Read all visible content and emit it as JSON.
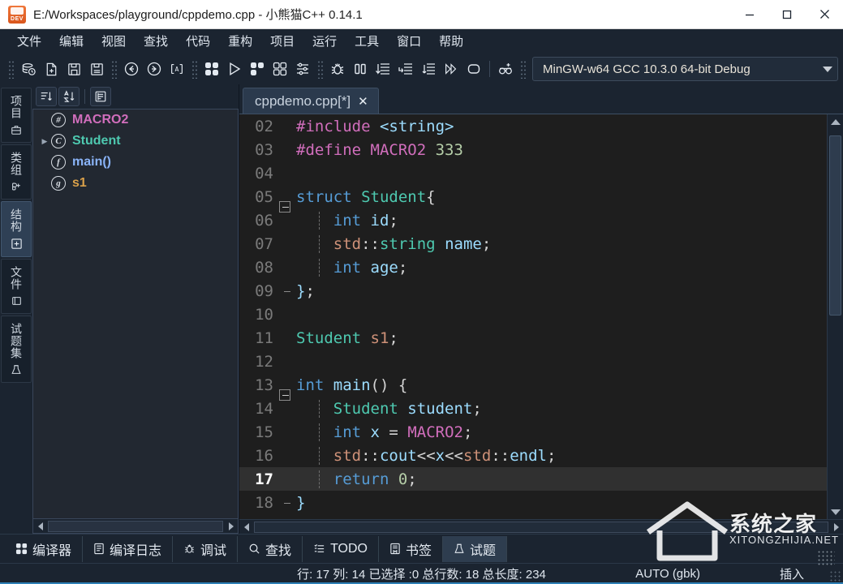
{
  "window": {
    "title_path": "E:/Workspaces/playground/cppdemo.cpp",
    "title_app": " - 小熊猫C++ 0.14.1",
    "icon_label": "DEV",
    "minimize_label": "最小化",
    "maximize_label": "最大化",
    "close_label": "关闭"
  },
  "menubar": {
    "items": [
      {
        "label": "文件",
        "name": "menu-file"
      },
      {
        "label": "编辑",
        "name": "menu-edit"
      },
      {
        "label": "视图",
        "name": "menu-view"
      },
      {
        "label": "查找",
        "name": "menu-search"
      },
      {
        "label": "代码",
        "name": "menu-code"
      },
      {
        "label": "重构",
        "name": "menu-refactor"
      },
      {
        "label": "项目",
        "name": "menu-project"
      },
      {
        "label": "运行",
        "name": "menu-run"
      },
      {
        "label": "工具",
        "name": "menu-tools"
      },
      {
        "label": "窗口",
        "name": "menu-window"
      },
      {
        "label": "帮助",
        "name": "menu-help"
      }
    ]
  },
  "toolbar": {
    "buttons": [
      {
        "name": "open-project-icon",
        "title": "打开项目"
      },
      {
        "name": "new-file-icon",
        "title": "新建文件"
      },
      {
        "name": "save-icon",
        "title": "保存"
      },
      {
        "name": "save-all-icon",
        "title": "全部保存"
      },
      {
        "name": "back-icon",
        "title": "后退"
      },
      {
        "name": "forward-icon",
        "title": "前进"
      },
      {
        "name": "auto-format-icon",
        "title": "格式化"
      },
      {
        "name": "compile-icon",
        "title": "编译"
      },
      {
        "name": "run-icon",
        "title": "运行"
      },
      {
        "name": "compile-run-icon",
        "title": "编译运行"
      },
      {
        "name": "rebuild-icon",
        "title": "重新编译"
      },
      {
        "name": "options-icon",
        "title": "选项"
      },
      {
        "name": "debug-icon",
        "title": "调试"
      },
      {
        "name": "pause-icon",
        "title": "暂停"
      },
      {
        "name": "step-over-icon",
        "title": "单步跳过"
      },
      {
        "name": "step-into-icon",
        "title": "单步进入"
      },
      {
        "name": "step-out-icon",
        "title": "单步跳出"
      },
      {
        "name": "continue-icon",
        "title": "继续"
      },
      {
        "name": "stop-icon",
        "title": "停止"
      },
      {
        "name": "add-watch-icon",
        "title": "添加监视"
      }
    ],
    "compiler_set": "MinGW-w64 GCC 10.3.0 64-bit Debug"
  },
  "left_tabs": [
    {
      "label": "项目",
      "icon": "briefcase-icon",
      "active": false,
      "name": "vtab-project"
    },
    {
      "label": "类组",
      "icon": "class-browser-icon",
      "active": false,
      "name": "vtab-classes"
    },
    {
      "label": "结构",
      "icon": "structure-icon",
      "active": true,
      "name": "vtab-structure"
    },
    {
      "label": "文件",
      "icon": "folder-icon",
      "active": false,
      "name": "vtab-files"
    },
    {
      "label": "试题集",
      "icon": "problem-set-icon",
      "active": false,
      "name": "vtab-problemset"
    }
  ],
  "structure_panel": {
    "toolbar": [
      {
        "name": "sort-by-type-icon",
        "title": "按类型排序"
      },
      {
        "name": "sort-alpha-icon",
        "title": "按字母排序"
      },
      {
        "name": "show-inherited-icon",
        "title": "显示继承成员"
      }
    ],
    "items": [
      {
        "label": "MACRO2",
        "icon": "#",
        "color": "#d16ebc",
        "expandable": false,
        "name": "structure-item-macro2"
      },
      {
        "label": "Student",
        "icon": "C",
        "color": "#4ec9b0",
        "expandable": true,
        "name": "structure-item-student"
      },
      {
        "label": "main()",
        "icon": "f",
        "color": "#8ab4f8",
        "expandable": false,
        "name": "structure-item-main"
      },
      {
        "label": "s1",
        "icon": "g",
        "color": "#d9a04a",
        "expandable": false,
        "name": "structure-item-s1"
      }
    ]
  },
  "editor": {
    "tab": {
      "label": "cppdemo.cpp[*]",
      "close": "✕"
    },
    "current_line": 17,
    "lines": [
      {
        "num": "02",
        "fold": "",
        "tokens": [
          {
            "t": "#include ",
            "c": "pp"
          },
          {
            "t": "<string>",
            "c": "str"
          }
        ]
      },
      {
        "num": "03",
        "fold": "",
        "tokens": [
          {
            "t": "#define ",
            "c": "pp"
          },
          {
            "t": "MACRO2",
            "c": "macro"
          },
          {
            "t": " ",
            "c": "pl"
          },
          {
            "t": "333",
            "c": "num"
          }
        ]
      },
      {
        "num": "04",
        "fold": "",
        "tokens": []
      },
      {
        "num": "05",
        "fold": "start",
        "tokens": [
          {
            "t": "struct ",
            "c": "kw"
          },
          {
            "t": "Student",
            "c": "type"
          },
          {
            "t": "{",
            "c": "pl"
          }
        ]
      },
      {
        "num": "06",
        "fold": "mid",
        "tokens": [
          {
            "t": "    ",
            "c": "pl"
          },
          {
            "t": "int ",
            "c": "kw"
          },
          {
            "t": "id",
            "c": "id"
          },
          {
            "t": ";",
            "c": "pl"
          }
        ]
      },
      {
        "num": "07",
        "fold": "mid",
        "tokens": [
          {
            "t": "    ",
            "c": "pl"
          },
          {
            "t": "std",
            "c": "ns"
          },
          {
            "t": "::",
            "c": "op"
          },
          {
            "t": "string",
            "c": "type"
          },
          {
            "t": " ",
            "c": "pl"
          },
          {
            "t": "name",
            "c": "id"
          },
          {
            "t": ";",
            "c": "pl"
          }
        ]
      },
      {
        "num": "08",
        "fold": "mid",
        "tokens": [
          {
            "t": "    ",
            "c": "pl"
          },
          {
            "t": "int ",
            "c": "kw"
          },
          {
            "t": "age",
            "c": "id"
          },
          {
            "t": ";",
            "c": "pl"
          }
        ]
      },
      {
        "num": "09",
        "fold": "end",
        "tokens": [
          {
            "t": "}",
            "c": "str"
          },
          {
            "t": ";",
            "c": "pl"
          }
        ]
      },
      {
        "num": "10",
        "fold": "",
        "tokens": []
      },
      {
        "num": "11",
        "fold": "",
        "tokens": [
          {
            "t": "Student",
            "c": "type"
          },
          {
            "t": " ",
            "c": "pl"
          },
          {
            "t": "s1",
            "c": "ns"
          },
          {
            "t": ";",
            "c": "pl"
          }
        ]
      },
      {
        "num": "12",
        "fold": "",
        "tokens": []
      },
      {
        "num": "13",
        "fold": "start",
        "tokens": [
          {
            "t": "int ",
            "c": "kw"
          },
          {
            "t": "main",
            "c": "id"
          },
          {
            "t": "() {",
            "c": "pl"
          }
        ]
      },
      {
        "num": "14",
        "fold": "mid",
        "tokens": [
          {
            "t": "    ",
            "c": "pl"
          },
          {
            "t": "Student",
            "c": "type"
          },
          {
            "t": " ",
            "c": "pl"
          },
          {
            "t": "student",
            "c": "str"
          },
          {
            "t": ";",
            "c": "pl"
          }
        ]
      },
      {
        "num": "15",
        "fold": "mid",
        "tokens": [
          {
            "t": "    ",
            "c": "pl"
          },
          {
            "t": "int ",
            "c": "kw"
          },
          {
            "t": "x ",
            "c": "id"
          },
          {
            "t": "= ",
            "c": "pl"
          },
          {
            "t": "MACRO2",
            "c": "macro"
          },
          {
            "t": ";",
            "c": "pl"
          }
        ]
      },
      {
        "num": "16",
        "fold": "mid",
        "tokens": [
          {
            "t": "    ",
            "c": "pl"
          },
          {
            "t": "std",
            "c": "ns"
          },
          {
            "t": "::",
            "c": "op"
          },
          {
            "t": "cout",
            "c": "str"
          },
          {
            "t": "<<",
            "c": "pl"
          },
          {
            "t": "x",
            "c": "str"
          },
          {
            "t": "<<",
            "c": "pl"
          },
          {
            "t": "std",
            "c": "ns"
          },
          {
            "t": "::",
            "c": "op"
          },
          {
            "t": "endl",
            "c": "str"
          },
          {
            "t": ";",
            "c": "pl"
          }
        ]
      },
      {
        "num": "17",
        "fold": "mid",
        "tokens": [
          {
            "t": "    ",
            "c": "pl"
          },
          {
            "t": "return ",
            "c": "kw"
          },
          {
            "t": "0",
            "c": "num"
          },
          {
            "t": ";",
            "c": "pl"
          }
        ]
      },
      {
        "num": "18",
        "fold": "end",
        "tokens": [
          {
            "t": "}",
            "c": "str"
          }
        ]
      }
    ]
  },
  "bottom_tabs": [
    {
      "label": "编译器",
      "icon": "compiler-icon",
      "active": false,
      "name": "bottom-tab-compiler"
    },
    {
      "label": "编译日志",
      "icon": "log-icon",
      "active": false,
      "name": "bottom-tab-compile-log"
    },
    {
      "label": "调试",
      "icon": "bug-icon",
      "active": false,
      "name": "bottom-tab-debug"
    },
    {
      "label": "查找",
      "icon": "search-icon",
      "active": false,
      "name": "bottom-tab-search"
    },
    {
      "label": "TODO",
      "icon": "todo-icon",
      "active": false,
      "name": "bottom-tab-todo"
    },
    {
      "label": "书签",
      "icon": "bookmark-icon",
      "active": false,
      "name": "bottom-tab-bookmark"
    },
    {
      "label": "试题",
      "icon": "problem-icon",
      "active": true,
      "name": "bottom-tab-problem"
    }
  ],
  "status_bar": {
    "position": "行: 17 列: 14 已选择 :0 总行数: 18 总长度: 234",
    "encoding": "AUTO (gbk)",
    "insert_mode": "插入",
    "accent_color": "#2e80b6"
  },
  "watermark": {
    "cn": "系统之家",
    "en": "XITONGZHIJIA.NET"
  }
}
